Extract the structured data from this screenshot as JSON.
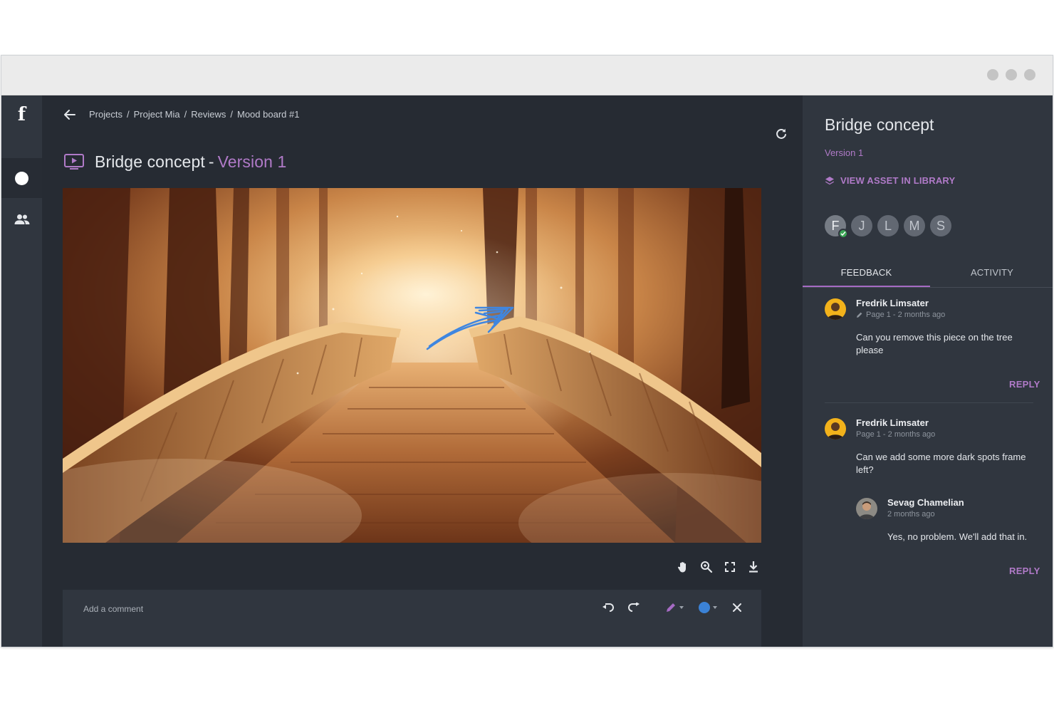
{
  "app": {
    "logo": "f"
  },
  "breadcrumb": [
    "Projects",
    "Project Mia",
    "Reviews",
    "Mood board #1"
  ],
  "main": {
    "title": "Bridge concept",
    "title_separator": "-",
    "version": "Version 1",
    "image_description_icon": "presentation-icon"
  },
  "view_tools": [
    "hand-icon",
    "zoom-icon",
    "fullscreen-icon",
    "download-icon"
  ],
  "comment_bar": {
    "placeholder": "Add a comment",
    "tools": [
      "undo-icon",
      "redo-icon",
      "pen-icon",
      "color-icon",
      "close-icon"
    ],
    "pen_color": "#a66bc4",
    "active_color": "#3b82d6"
  },
  "panel": {
    "title": "Bridge concept",
    "version": "Version 1",
    "view_asset": "VIEW ASSET IN LIBRARY",
    "avatars": [
      "F",
      "J",
      "L",
      "M",
      "S"
    ],
    "tabs": [
      "FEEDBACK",
      "ACTIVITY"
    ],
    "active_tab": "FEEDBACK"
  },
  "feedback": [
    {
      "author": "Fredrik Limsater",
      "meta": "Page 1 - 2 months ago",
      "text": "Can you remove this piece on the tree please",
      "reply": "REPLY"
    },
    {
      "author": "Fredrik Limsater",
      "meta": "Page 1 - 2 months ago",
      "text": "Can we add some more dark spots frame left?",
      "reply": "REPLY",
      "replies": [
        {
          "author": "Sevag Chamelian",
          "meta": "2 months ago",
          "text": "Yes, no problem. We'll add that in."
        }
      ]
    }
  ],
  "colors": {
    "accent": "#b07ac8",
    "background": "#262b33",
    "panel": "#30363f"
  }
}
